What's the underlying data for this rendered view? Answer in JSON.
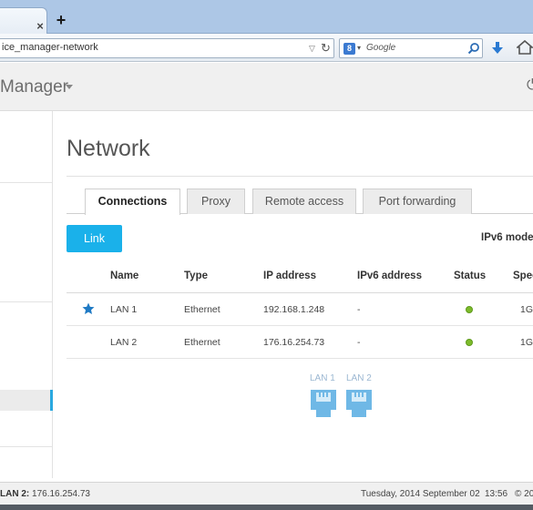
{
  "browser": {
    "tab_close_glyph": "×",
    "new_tab_glyph": "+",
    "url": "ice_manager-network",
    "search_placeholder": "Google",
    "search_engine_glyph": "8"
  },
  "header": {
    "title": "Manager",
    "right_icon": "power-icon"
  },
  "page": {
    "title": "Network"
  },
  "tabs": [
    {
      "label": "Connections",
      "active": true
    },
    {
      "label": "Proxy",
      "active": false
    },
    {
      "label": "Remote access",
      "active": false
    },
    {
      "label": "Port forwarding",
      "active": false
    }
  ],
  "toolbar": {
    "link_label": "Link",
    "ipv6_mode_label": "IPv6 mode"
  },
  "table": {
    "columns": [
      "Name",
      "Type",
      "IP address",
      "IPv6 address",
      "Status",
      "Speed"
    ],
    "rows": [
      {
        "starred": true,
        "name": "LAN 1",
        "type": "Ethernet",
        "ip": "192.168.1.248",
        "ipv6": "-",
        "status": "up",
        "speed": "1G"
      },
      {
        "starred": false,
        "name": "LAN 2",
        "type": "Ethernet",
        "ip": "176.16.254.73",
        "ipv6": "-",
        "status": "up",
        "speed": "1G"
      }
    ]
  },
  "ports": {
    "lan1_label": "LAN 1",
    "lan2_label": "LAN 2"
  },
  "statusbar": {
    "interface_label": "LAN 2:",
    "interface_ip": "176.16.254.73",
    "date": "Tuesday, 2014 September 02",
    "time": "13:56",
    "copyright": "© 20"
  },
  "colors": {
    "accent": "#1ab1ea",
    "status_up": "#7dbb2b",
    "star": "#1f7ac4",
    "port": "#6fb8e6"
  }
}
